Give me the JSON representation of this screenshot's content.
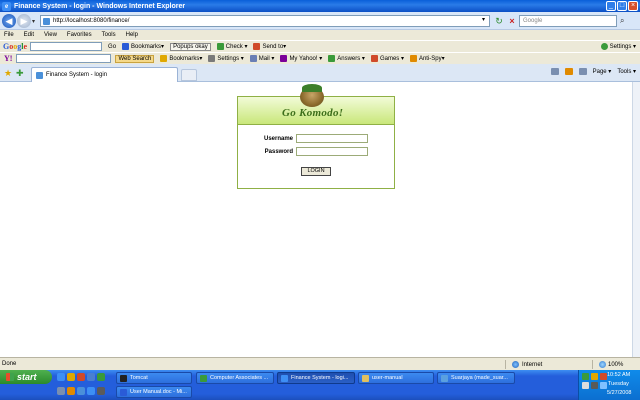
{
  "window": {
    "title": "Finance System - login - Windows Internet Explorer"
  },
  "address": {
    "url": "http://localhost:8080/finance/",
    "search_placeholder": "Google"
  },
  "menu": [
    "File",
    "Edit",
    "View",
    "Favorites",
    "Tools",
    "Help"
  ],
  "google_toolbar": {
    "logo": "Google",
    "go": "Go",
    "bookmarks": "Bookmarks▾",
    "popups": "Popups okay",
    "check": "Check ▾",
    "send_to": "Send to▾",
    "settings": "Settings ▾"
  },
  "yahoo_toolbar": {
    "logo": "Y!",
    "web_search": "Web Search",
    "bookmarks": "Bookmarks▾",
    "settings": "Settings ▾",
    "mail": "Mail ▾",
    "my_yahoo": "My Yahoo! ▾",
    "answers": "Answers ▾",
    "games": "Games ▾",
    "antispy": "Anti-Spy▾"
  },
  "tab": {
    "label": "Finance System - login"
  },
  "command_bar": {
    "page": "Page ▾",
    "tools": "Tools ▾"
  },
  "login": {
    "brand": "Go Komodo!",
    "username_label": "Username",
    "password_label": "Password",
    "button": "LOGIN"
  },
  "status": {
    "text": "Done",
    "zone": "Internet",
    "zoom": "100%"
  },
  "taskbar": {
    "start": "start",
    "items": [
      "Tomcat",
      "Computer Associates ...",
      "Finance System - logi...",
      "user-manual",
      "Suarjaya (made_suar...",
      "User Manual.doc - Mi..."
    ]
  },
  "clock": {
    "time": "10:52 AM",
    "day": "Tuesday",
    "date": "5/27/2008"
  }
}
